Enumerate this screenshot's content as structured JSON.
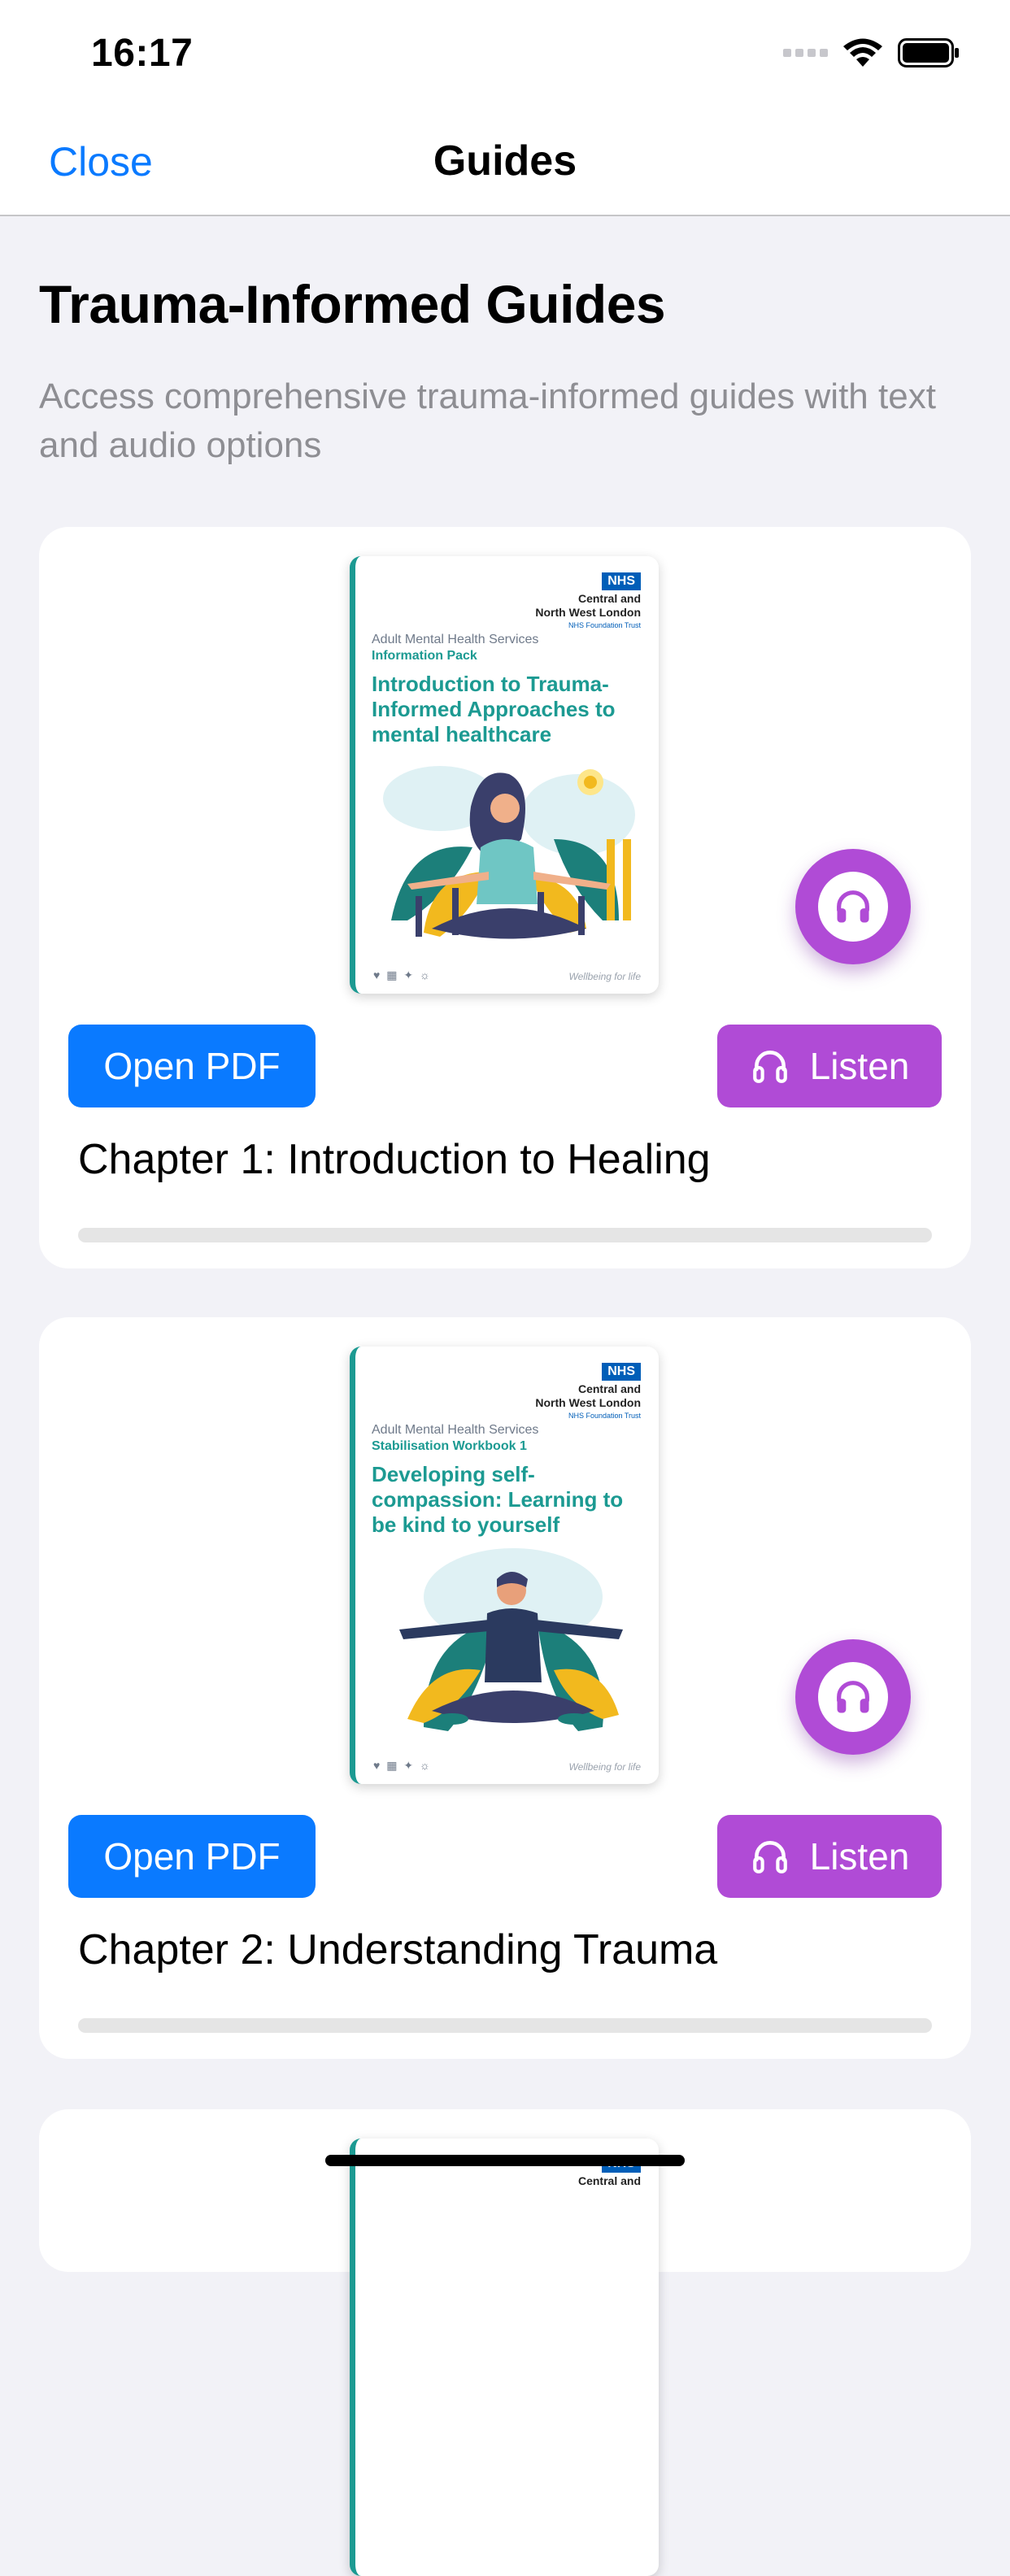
{
  "status_bar": {
    "time": "16:17"
  },
  "nav": {
    "close_label": "Close",
    "title": "Guides"
  },
  "page": {
    "title": "Trauma-Informed Guides",
    "subtitle": "Access comprehensive trauma-informed guides with text and audio options"
  },
  "colors": {
    "accent_blue": "#0a7aff",
    "listen_purple": "#b04bd6",
    "cover_teal": "#1c9a92",
    "nhs_blue": "#005eb8"
  },
  "guides": [
    {
      "cover": {
        "nhs_badge": "NHS",
        "org_line1": "Central and",
        "org_line2": "North West London",
        "org_sub": "NHS Foundation Trust",
        "series": "Adult Mental Health Services",
        "pack": "Information Pack",
        "heading": "Introduction to Trauma-Informed Approaches to mental healthcare",
        "footer": "Wellbeing for life"
      },
      "open_pdf_label": "Open PDF",
      "listen_label": "Listen",
      "chapter_title": "Chapter 1: Introduction to Healing",
      "progress": 0
    },
    {
      "cover": {
        "nhs_badge": "NHS",
        "org_line1": "Central and",
        "org_line2": "North West London",
        "org_sub": "NHS Foundation Trust",
        "series": "Adult Mental Health Services",
        "pack": "Stabilisation Workbook 1",
        "heading": "Developing self-compassion: Learning to be kind to yourself",
        "footer": "Wellbeing for life"
      },
      "open_pdf_label": "Open PDF",
      "listen_label": "Listen",
      "chapter_title": "Chapter 2: Understanding Trauma",
      "progress": 0
    },
    {
      "cover": {
        "nhs_badge": "NHS",
        "org_line1": "Central and"
      }
    }
  ],
  "icons": {
    "wifi": "wifi-icon",
    "battery": "battery-icon",
    "headphones": "headphones-icon"
  }
}
